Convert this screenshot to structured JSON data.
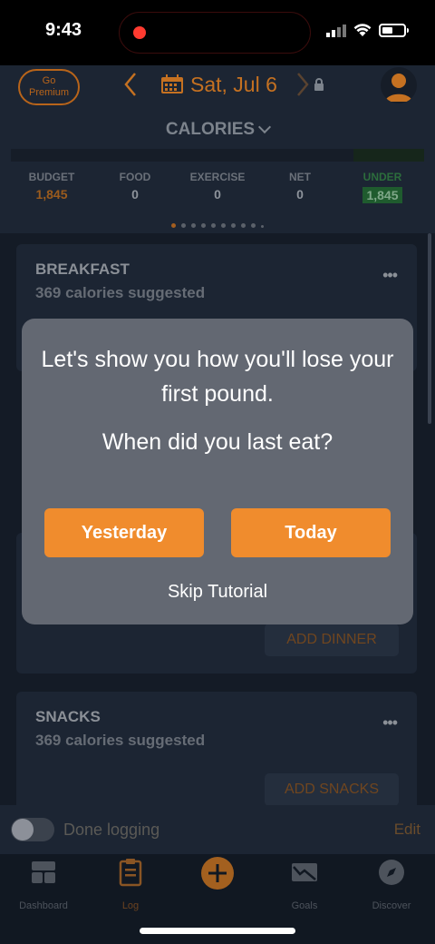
{
  "status_bar": {
    "time": "9:43"
  },
  "header": {
    "premium_line1": "Go",
    "premium_line2": "Premium",
    "date": "Sat, Jul 6",
    "section_title": "CALORIES"
  },
  "stats": {
    "budget": {
      "label": "BUDGET",
      "value": "1,845"
    },
    "food": {
      "label": "FOOD",
      "value": "0"
    },
    "exercise": {
      "label": "EXERCISE",
      "value": "0"
    },
    "net": {
      "label": "NET",
      "value": "0"
    },
    "under": {
      "label": "UNDER",
      "value": "1,845"
    }
  },
  "meals": {
    "breakfast": {
      "title": "BREAKFAST",
      "suggested": "369 calories suggested"
    },
    "dinner": {
      "add_label": "ADD DINNER"
    },
    "snacks": {
      "title": "SNACKS",
      "suggested": "369 calories suggested",
      "add_label": "ADD SNACKS"
    }
  },
  "footer": {
    "done_logging": "Done logging",
    "edit": "Edit"
  },
  "tabs": [
    {
      "label": "Dashboard"
    },
    {
      "label": "Log"
    },
    {
      "label": ""
    },
    {
      "label": "Goals"
    },
    {
      "label": "Discover"
    }
  ],
  "dialog": {
    "message": "Let's show you how you'll lose your first pound.",
    "question": "When did you last eat?",
    "yesterday": "Yesterday",
    "today": "Today",
    "skip": "Skip Tutorial"
  },
  "colors": {
    "accent": "#f08c2d",
    "background": "#1d2634",
    "dialog": "#636872"
  }
}
